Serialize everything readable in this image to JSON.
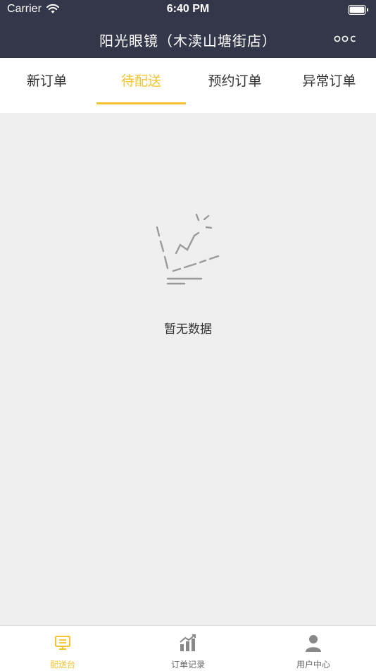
{
  "status_bar": {
    "carrier": "Carrier",
    "time": "6:40 PM"
  },
  "nav": {
    "title": "阳光眼镜（木渎山塘街店）",
    "more_icon": "more-dots-icon"
  },
  "tabs": [
    {
      "label": "新订单",
      "active": false
    },
    {
      "label": "待配送",
      "active": true
    },
    {
      "label": "预约订单",
      "active": false
    },
    {
      "label": "异常订单",
      "active": false
    }
  ],
  "empty_state": {
    "icon": "empty-chart-icon",
    "text": "暂无数据"
  },
  "bottom_nav": [
    {
      "label": "配送台",
      "icon": "monitor-icon",
      "active": true
    },
    {
      "label": "订单记录",
      "icon": "bar-chart-icon",
      "active": false
    },
    {
      "label": "用户中心",
      "icon": "user-icon",
      "active": false
    }
  ],
  "colors": {
    "header_bg": "#343649",
    "accent": "#f4c430",
    "content_bg": "#efefef"
  }
}
